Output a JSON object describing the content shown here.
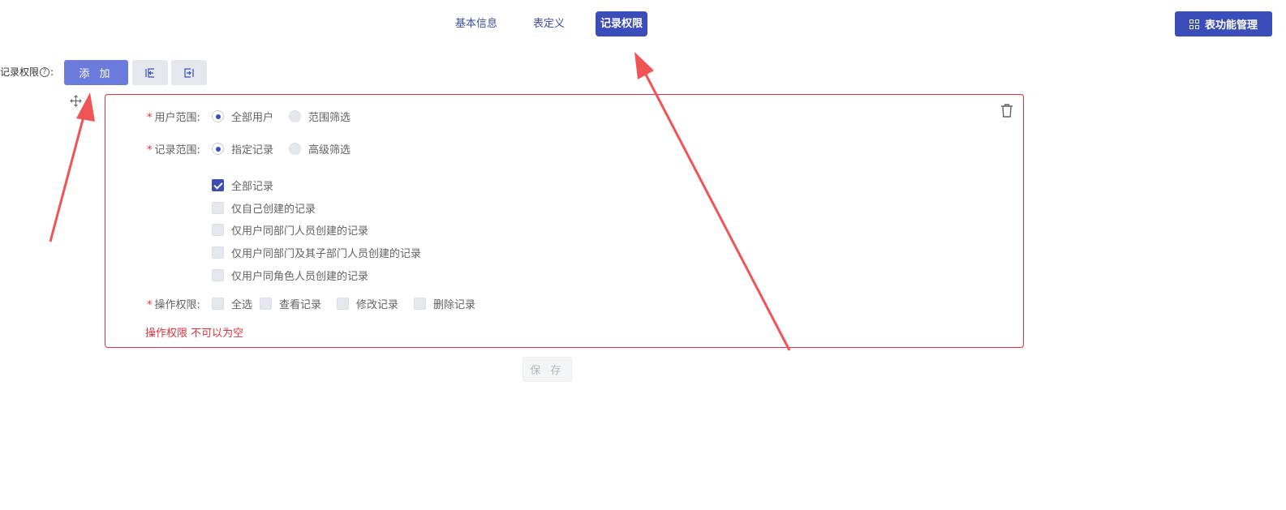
{
  "tabs": [
    {
      "label": "基本信息",
      "active": false
    },
    {
      "label": "表定义",
      "active": false
    },
    {
      "label": "记录权限",
      "active": true
    }
  ],
  "header": {
    "table_function_button": "表功能管理",
    "table_function_icon": "grid-icon"
  },
  "toolbar": {
    "label": "记录权限",
    "colon": ":",
    "help_icon": "question-circle-icon",
    "help_glyph": "?",
    "add_button": "添 加",
    "import_icon": "import-icon",
    "export_icon": "export-icon"
  },
  "rule": {
    "move_icon": "move-icon",
    "delete_icon": "trash-icon",
    "user_scope": {
      "label": "用户范围:",
      "options": [
        {
          "label": "全部用户",
          "checked": true
        },
        {
          "label": "范围筛选",
          "checked": false
        }
      ]
    },
    "record_scope": {
      "label": "记录范围:",
      "options": [
        {
          "label": "指定记录",
          "checked": true
        },
        {
          "label": "高级筛选",
          "checked": false
        }
      ],
      "records": [
        {
          "label": "全部记录",
          "checked": true
        },
        {
          "label": "仅自己创建的记录",
          "checked": false
        },
        {
          "label": "仅用户同部门人员创建的记录",
          "checked": false
        },
        {
          "label": "仅用户同部门及其子部门人员创建的记录",
          "checked": false
        },
        {
          "label": "仅用户同角色人员创建的记录",
          "checked": false
        }
      ]
    },
    "operation": {
      "label": "操作权限:",
      "options": [
        {
          "label": "全选",
          "checked": false
        },
        {
          "label": "查看记录",
          "checked": false
        },
        {
          "label": "修改记录",
          "checked": false
        },
        {
          "label": "删除记录",
          "checked": false
        }
      ],
      "error": "操作权限 不可以为空"
    }
  },
  "save_button": "保 存",
  "colors": {
    "primary": "#3b4db8",
    "add_button": "#6a7bdc",
    "error": "#e3323f",
    "annotation_arrow": "#f05454"
  }
}
